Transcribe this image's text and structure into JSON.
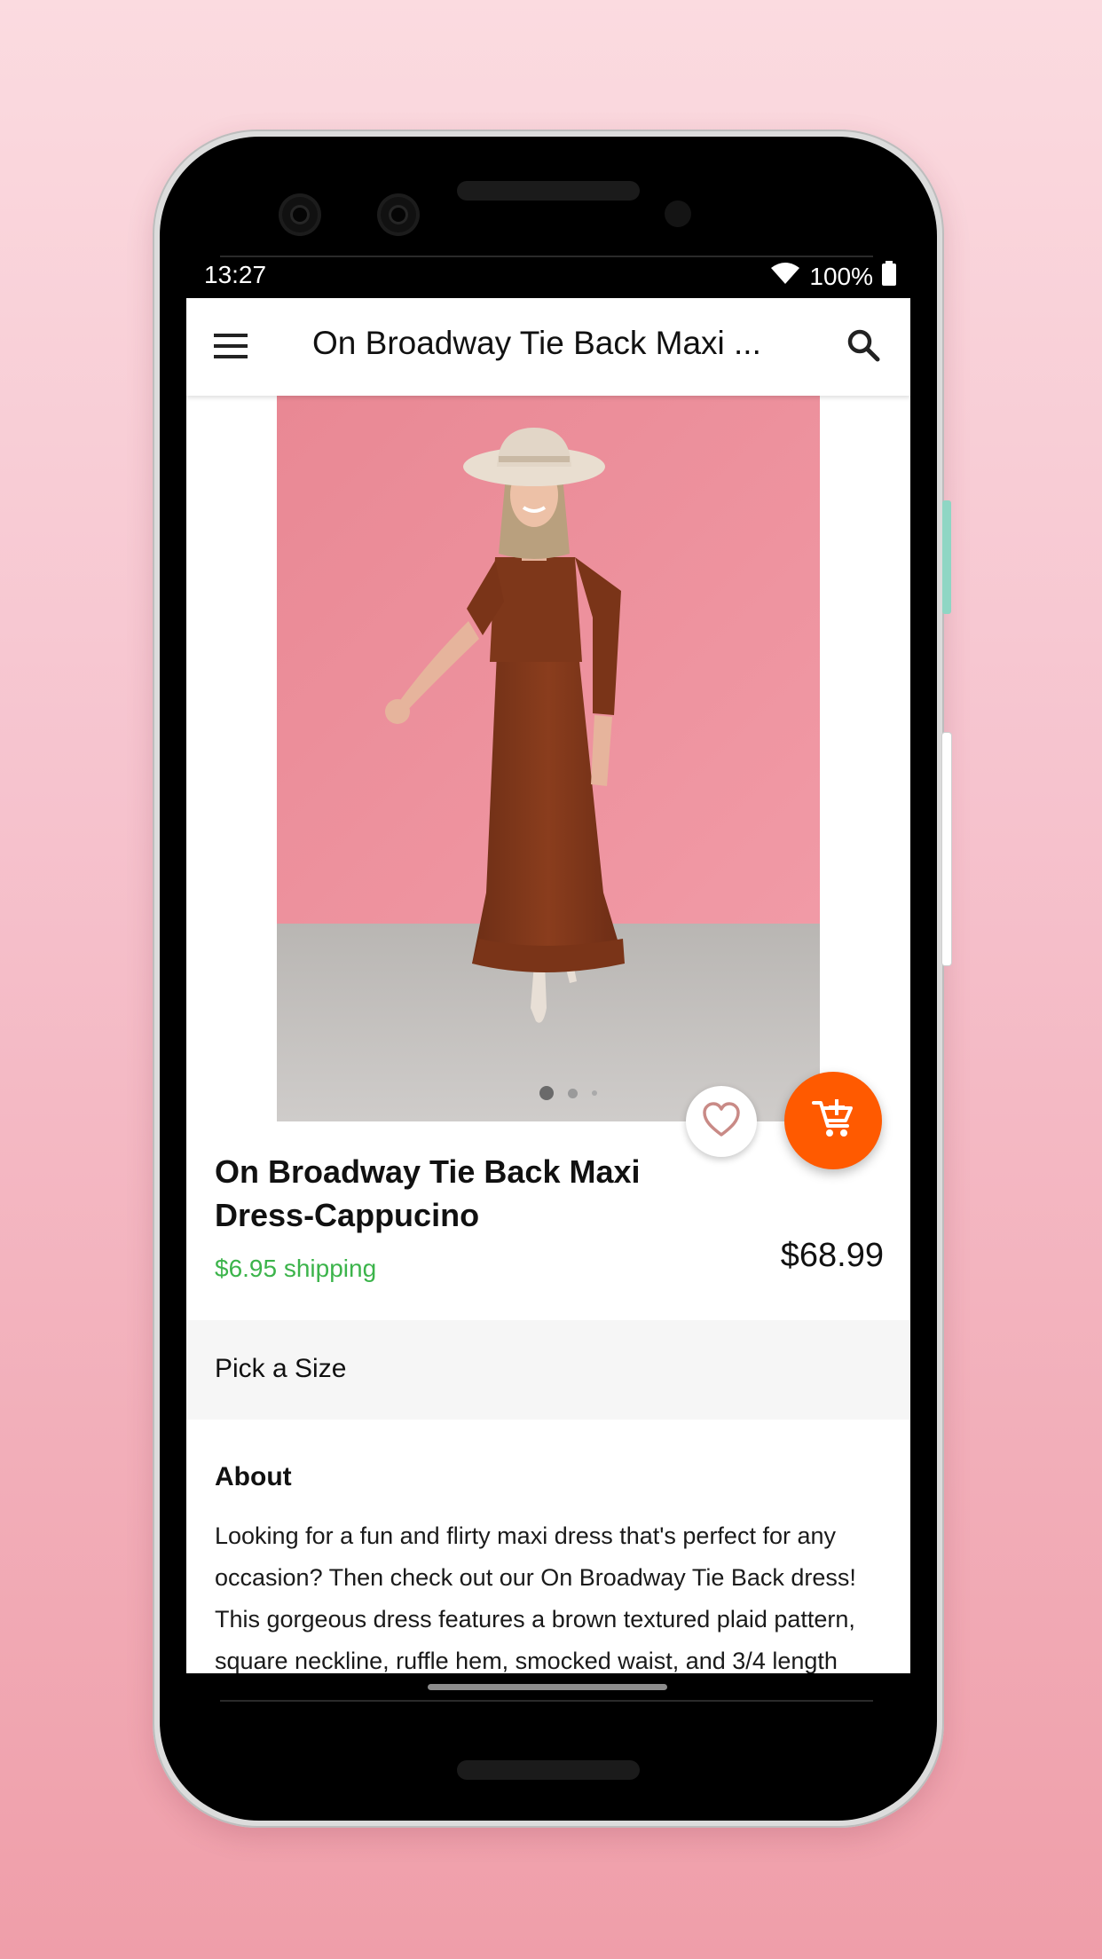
{
  "status_bar": {
    "time": "13:27",
    "battery": "100%"
  },
  "app_bar": {
    "title": "On Broadway Tie Back Maxi ...",
    "menu_icon": "hamburger-menu-icon",
    "search_icon": "search-icon"
  },
  "gallery": {
    "current_image": 1,
    "image_count": 3
  },
  "actions": {
    "favorite_icon": "heart-outline-icon",
    "cart_icon": "add-to-cart-icon",
    "cart_color": "#ff5a00"
  },
  "product": {
    "name": "On Broadway Tie Back Maxi Dress-Cappucino",
    "shipping": "$6.95 shipping",
    "price": "$68.99",
    "shipping_color": "#3cb44b"
  },
  "size": {
    "label": "Pick a Size"
  },
  "about": {
    "title": "About",
    "text": "Looking for a fun and flirty maxi dress that's perfect for any occasion? Then check out our On Broadway Tie Back dress! This gorgeous dress features a brown textured plaid pattern, square neckline, ruffle hem, smocked waist, and 3/4 length"
  }
}
